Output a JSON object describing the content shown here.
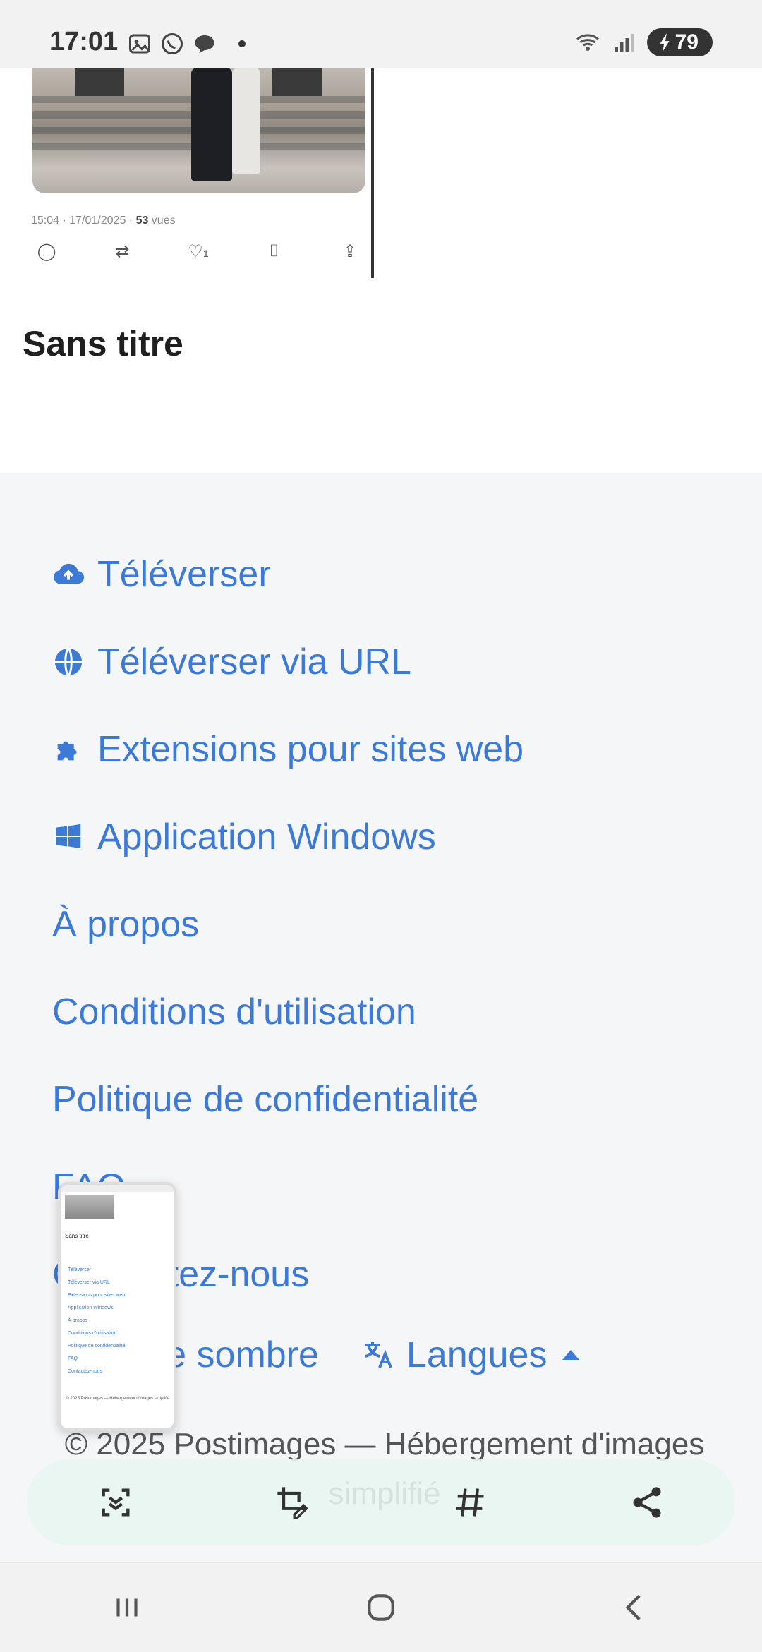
{
  "status_bar": {
    "time": "17:01",
    "battery": "79"
  },
  "tweet": {
    "meta_time": "15:04 · 17/01/2025 · ",
    "meta_views": "53",
    "meta_views_label": " vues",
    "like_count": "1"
  },
  "page": {
    "image_title": "Sans titre"
  },
  "footer": {
    "links": [
      {
        "label": "Téléverser",
        "icon": "cloud-upload-icon"
      },
      {
        "label": "Téléverser via URL",
        "icon": "globe-icon"
      },
      {
        "label": "Extensions pour sites web",
        "icon": "puzzle-icon"
      },
      {
        "label": "Application Windows",
        "icon": "windows-icon"
      },
      {
        "label": "À propos"
      },
      {
        "label": "Conditions d'utilisation"
      },
      {
        "label": "Politique de confidentialité"
      },
      {
        "label": "FAQ"
      },
      {
        "label": "Contactez-nous"
      }
    ],
    "dark_mode_label": "Mode sombre",
    "languages_label": "Langues",
    "copyright": "© 2025 Postimages — Hébergement d'images simplifié"
  },
  "colors": {
    "link": "#3d7ad6",
    "background": "#f5f6f8",
    "toolbar": "#e8f6f0"
  }
}
